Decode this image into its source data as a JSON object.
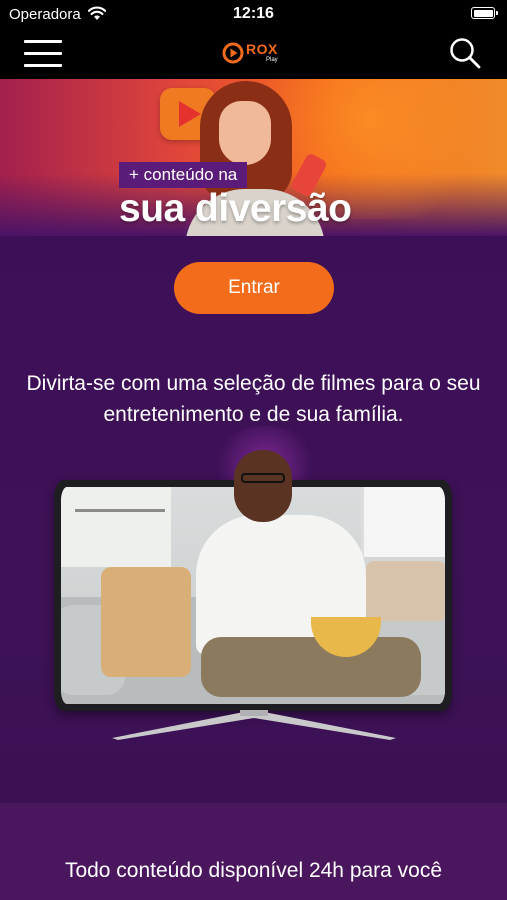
{
  "status_bar": {
    "carrier": "Operadora",
    "time": "12:16"
  },
  "nav": {
    "logo_text": "ROX",
    "logo_sub": "Play"
  },
  "hero": {
    "tag": "+ conteúdo na",
    "title": "sua diversão"
  },
  "main": {
    "enter_label": "Entrar",
    "description": "Divirta-se com uma seleção de filmes para o seu entretenimento e de sua família."
  },
  "bottom": {
    "text": "Todo conteúdo disponível 24h para você"
  },
  "icons": [
    "wifi-icon",
    "battery-icon",
    "menu-icon",
    "rox-play-logo",
    "search-icon"
  ],
  "colors": {
    "accent": "#f26c1c",
    "background": "#3d0f57",
    "bar": "#000000"
  }
}
